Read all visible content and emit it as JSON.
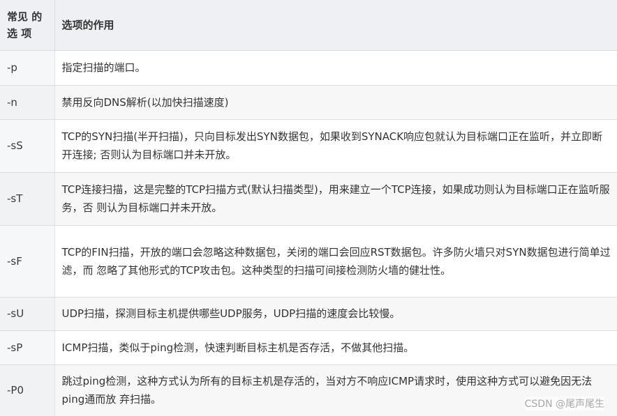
{
  "table": {
    "header": {
      "col1_line1": "常见 的",
      "col1_line2": "选 项",
      "col2": "选项的作用"
    },
    "rows": [
      {
        "option": "-p",
        "desc": "指定扫描的端口。"
      },
      {
        "option": "-n",
        "desc": "禁用反向DNS解析(以加快扫描速度)"
      },
      {
        "option": "-sS",
        "desc": "TCP的SYN扫描(半开扫描)，只向目标发出SYN数据包，如果收到SYNACK响应包就认为目标端口正在监听，并立即断开连接; 否则认为目标端口并未开放。"
      },
      {
        "option": "-sT",
        "desc": "TCP连接扫描，这是完整的TCP扫描方式(默认扫描类型)，用来建立一个TCP连接，如果成功则认为目标端口正在监听服务，否 则认为目标端口并未开放。"
      },
      {
        "option": "-sF",
        "desc": "TCP的FIN扫描，开放的端口会忽略这种数据包，关闭的端口会回应RST数据包。许多防火墙只对SYN数据包进行简单过滤，而 忽略了其他形式的TCP攻击包。这种类型的扫描可间接检测防火墙的健壮性。"
      },
      {
        "option": "-sU",
        "desc": "UDP扫描，探测目标主机提供哪些UDP服务，UDP扫描的速度会比较慢。"
      },
      {
        "option": "-sP",
        "desc": "ICMP扫描，类似于ping检测，快速判断目标主机是否存活，不做其他扫描。"
      },
      {
        "option": "-P0",
        "desc": "跳过ping检测，这种方式认为所有的目标主机是存活的，当对方不响应ICMP请求时，使用这种方式可以避免因无法ping通而放 弃扫描。"
      }
    ]
  },
  "watermark": "CSDN @尾声尾生"
}
